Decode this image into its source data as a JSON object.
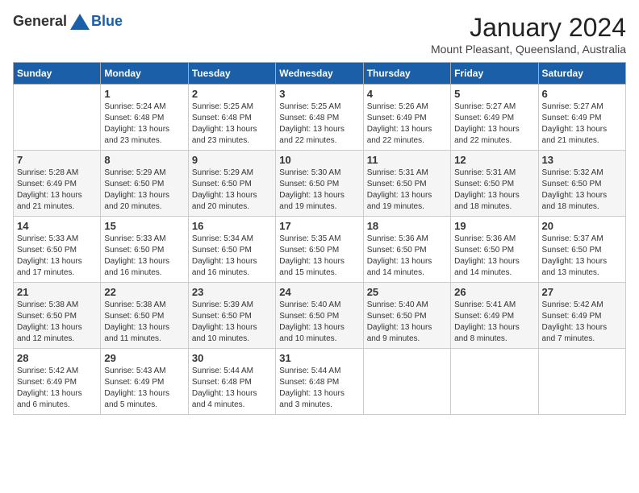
{
  "header": {
    "logo_general": "General",
    "logo_blue": "Blue",
    "month_year": "January 2024",
    "location": "Mount Pleasant, Queensland, Australia"
  },
  "days_of_week": [
    "Sunday",
    "Monday",
    "Tuesday",
    "Wednesday",
    "Thursday",
    "Friday",
    "Saturday"
  ],
  "weeks": [
    [
      {
        "day": "",
        "info": ""
      },
      {
        "day": "1",
        "info": "Sunrise: 5:24 AM\nSunset: 6:48 PM\nDaylight: 13 hours\nand 23 minutes."
      },
      {
        "day": "2",
        "info": "Sunrise: 5:25 AM\nSunset: 6:48 PM\nDaylight: 13 hours\nand 23 minutes."
      },
      {
        "day": "3",
        "info": "Sunrise: 5:25 AM\nSunset: 6:48 PM\nDaylight: 13 hours\nand 22 minutes."
      },
      {
        "day": "4",
        "info": "Sunrise: 5:26 AM\nSunset: 6:49 PM\nDaylight: 13 hours\nand 22 minutes."
      },
      {
        "day": "5",
        "info": "Sunrise: 5:27 AM\nSunset: 6:49 PM\nDaylight: 13 hours\nand 22 minutes."
      },
      {
        "day": "6",
        "info": "Sunrise: 5:27 AM\nSunset: 6:49 PM\nDaylight: 13 hours\nand 21 minutes."
      }
    ],
    [
      {
        "day": "7",
        "info": "Sunrise: 5:28 AM\nSunset: 6:49 PM\nDaylight: 13 hours\nand 21 minutes."
      },
      {
        "day": "8",
        "info": "Sunrise: 5:29 AM\nSunset: 6:50 PM\nDaylight: 13 hours\nand 20 minutes."
      },
      {
        "day": "9",
        "info": "Sunrise: 5:29 AM\nSunset: 6:50 PM\nDaylight: 13 hours\nand 20 minutes."
      },
      {
        "day": "10",
        "info": "Sunrise: 5:30 AM\nSunset: 6:50 PM\nDaylight: 13 hours\nand 19 minutes."
      },
      {
        "day": "11",
        "info": "Sunrise: 5:31 AM\nSunset: 6:50 PM\nDaylight: 13 hours\nand 19 minutes."
      },
      {
        "day": "12",
        "info": "Sunrise: 5:31 AM\nSunset: 6:50 PM\nDaylight: 13 hours\nand 18 minutes."
      },
      {
        "day": "13",
        "info": "Sunrise: 5:32 AM\nSunset: 6:50 PM\nDaylight: 13 hours\nand 18 minutes."
      }
    ],
    [
      {
        "day": "14",
        "info": "Sunrise: 5:33 AM\nSunset: 6:50 PM\nDaylight: 13 hours\nand 17 minutes."
      },
      {
        "day": "15",
        "info": "Sunrise: 5:33 AM\nSunset: 6:50 PM\nDaylight: 13 hours\nand 16 minutes."
      },
      {
        "day": "16",
        "info": "Sunrise: 5:34 AM\nSunset: 6:50 PM\nDaylight: 13 hours\nand 16 minutes."
      },
      {
        "day": "17",
        "info": "Sunrise: 5:35 AM\nSunset: 6:50 PM\nDaylight: 13 hours\nand 15 minutes."
      },
      {
        "day": "18",
        "info": "Sunrise: 5:36 AM\nSunset: 6:50 PM\nDaylight: 13 hours\nand 14 minutes."
      },
      {
        "day": "19",
        "info": "Sunrise: 5:36 AM\nSunset: 6:50 PM\nDaylight: 13 hours\nand 14 minutes."
      },
      {
        "day": "20",
        "info": "Sunrise: 5:37 AM\nSunset: 6:50 PM\nDaylight: 13 hours\nand 13 minutes."
      }
    ],
    [
      {
        "day": "21",
        "info": "Sunrise: 5:38 AM\nSunset: 6:50 PM\nDaylight: 13 hours\nand 12 minutes."
      },
      {
        "day": "22",
        "info": "Sunrise: 5:38 AM\nSunset: 6:50 PM\nDaylight: 13 hours\nand 11 minutes."
      },
      {
        "day": "23",
        "info": "Sunrise: 5:39 AM\nSunset: 6:50 PM\nDaylight: 13 hours\nand 10 minutes."
      },
      {
        "day": "24",
        "info": "Sunrise: 5:40 AM\nSunset: 6:50 PM\nDaylight: 13 hours\nand 10 minutes."
      },
      {
        "day": "25",
        "info": "Sunrise: 5:40 AM\nSunset: 6:50 PM\nDaylight: 13 hours\nand 9 minutes."
      },
      {
        "day": "26",
        "info": "Sunrise: 5:41 AM\nSunset: 6:49 PM\nDaylight: 13 hours\nand 8 minutes."
      },
      {
        "day": "27",
        "info": "Sunrise: 5:42 AM\nSunset: 6:49 PM\nDaylight: 13 hours\nand 7 minutes."
      }
    ],
    [
      {
        "day": "28",
        "info": "Sunrise: 5:42 AM\nSunset: 6:49 PM\nDaylight: 13 hours\nand 6 minutes."
      },
      {
        "day": "29",
        "info": "Sunrise: 5:43 AM\nSunset: 6:49 PM\nDaylight: 13 hours\nand 5 minutes."
      },
      {
        "day": "30",
        "info": "Sunrise: 5:44 AM\nSunset: 6:48 PM\nDaylight: 13 hours\nand 4 minutes."
      },
      {
        "day": "31",
        "info": "Sunrise: 5:44 AM\nSunset: 6:48 PM\nDaylight: 13 hours\nand 3 minutes."
      },
      {
        "day": "",
        "info": ""
      },
      {
        "day": "",
        "info": ""
      },
      {
        "day": "",
        "info": ""
      }
    ]
  ]
}
